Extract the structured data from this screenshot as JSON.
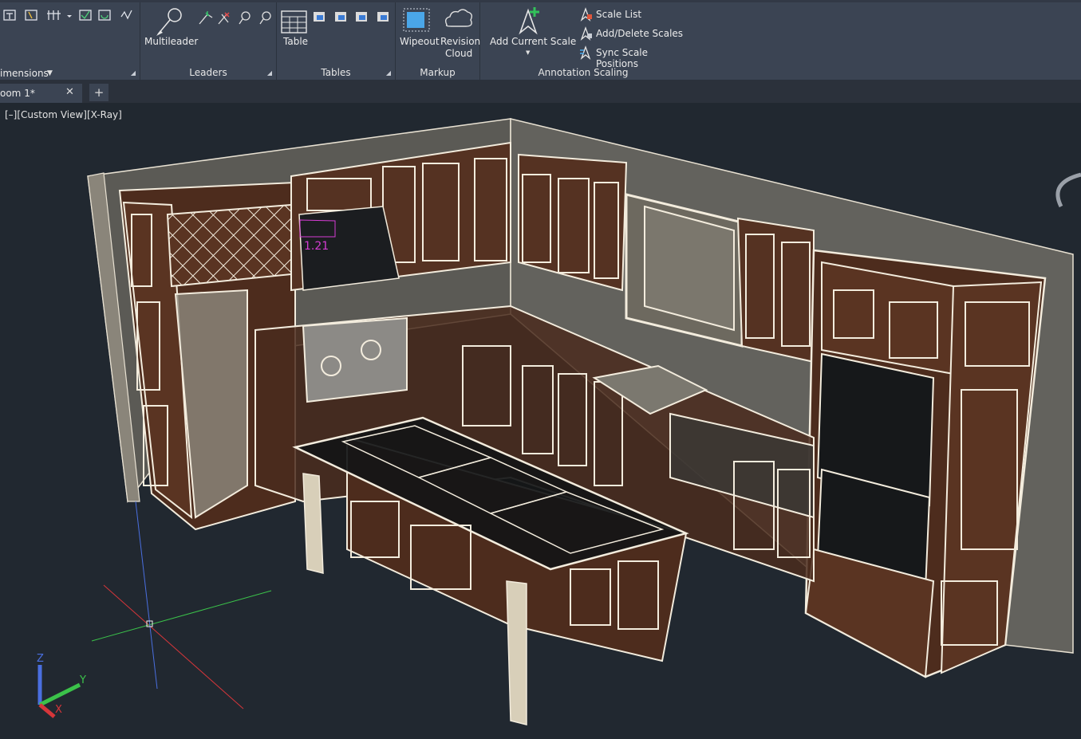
{
  "ribbon": {
    "dimensions_panel": {
      "title": "imensions"
    },
    "leaders_panel": {
      "title": "Leaders",
      "multileader_label": "Multileader"
    },
    "tables_panel": {
      "title": "Tables",
      "table_label": "Table"
    },
    "markup_panel": {
      "title": "Markup",
      "wipeout_label": "Wipeout",
      "revision_cloud_label_1": "Revision",
      "revision_cloud_label_2": "Cloud"
    },
    "annotation_scaling_panel": {
      "title": "Annotation Scaling",
      "add_current_scale_label": "Add Current Scale",
      "scale_list_label": "Scale List",
      "add_delete_scales_label": "Add/Delete Scales",
      "sync_scale_positions_label": "Sync Scale Positions"
    }
  },
  "tabs": {
    "document_tab_label": "oom 1*",
    "close_symbol": "✕",
    "new_tab_symbol": "+"
  },
  "viewport": {
    "view_label": "[–][Custom View][X-Ray]",
    "dimension_text": "1.21",
    "ucs_labels": {
      "z": "Z",
      "y": "Y",
      "x": "X"
    }
  },
  "colors": {
    "ribbon_bg": "#3b4453",
    "viewport_bg": "#212830",
    "wireframe": "#f3ecdd",
    "wood": "#5a3422",
    "wall": "#777268",
    "accent_green": "#32c15a",
    "accent_blue": "#4aa6e8"
  }
}
